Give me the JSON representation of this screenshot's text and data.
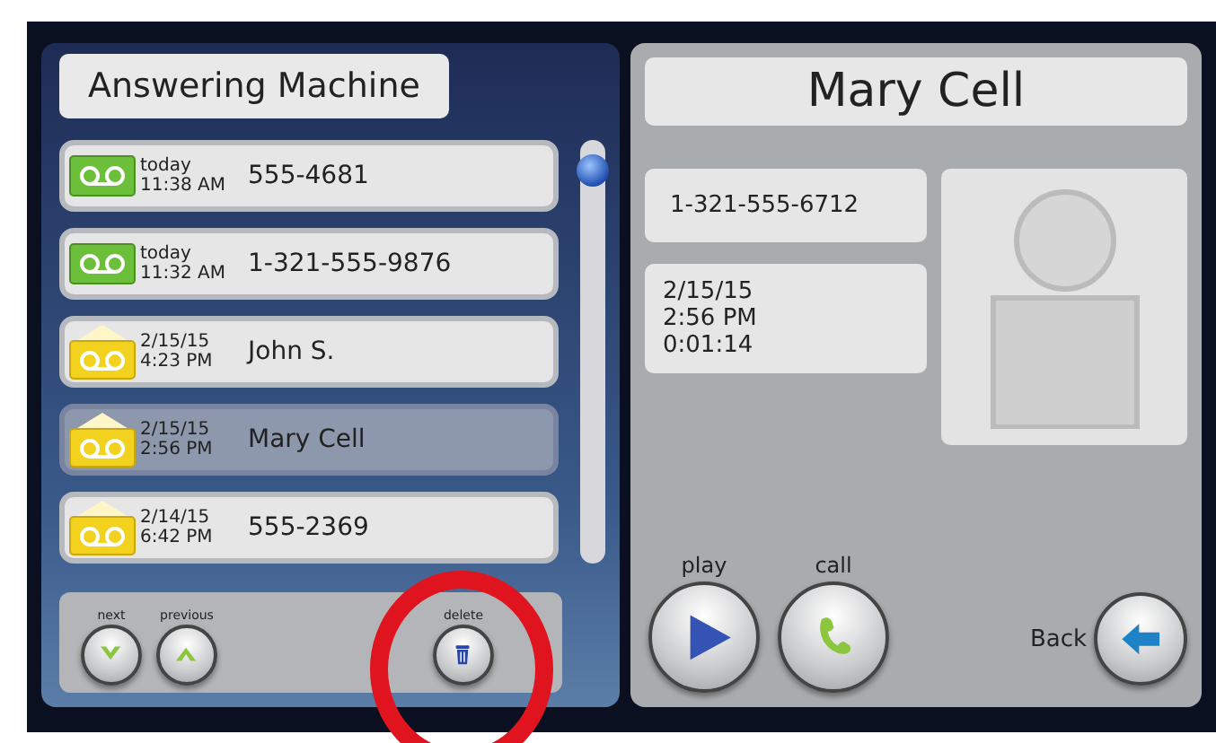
{
  "list_title": "Answering Machine",
  "messages": [
    {
      "date": "today",
      "time": "11:38 AM",
      "caller": "555-4681",
      "new": true,
      "selected": false
    },
    {
      "date": "today",
      "time": "11:32 AM",
      "caller": "1-321-555-9876",
      "new": true,
      "selected": false
    },
    {
      "date": "2/15/15",
      "time": "4:23 PM",
      "caller": "John S.",
      "new": false,
      "selected": false
    },
    {
      "date": "2/15/15",
      "time": "2:56 PM",
      "caller": "Mary Cell",
      "new": false,
      "selected": true
    },
    {
      "date": "2/14/15",
      "time": "6:42 PM",
      "caller": "555-2369",
      "new": false,
      "selected": false
    }
  ],
  "nav_buttons": [
    {
      "label": "next",
      "kind": "down"
    },
    {
      "label": "previous",
      "kind": "up"
    },
    {
      "label": "delete",
      "kind": "trash"
    }
  ],
  "detail": {
    "name": "Mary Cell",
    "number": "1-321-555-6712",
    "info_lines": [
      "2/15/15",
      "2:56 PM",
      "0:01:14"
    ]
  },
  "actions": [
    {
      "label": "play",
      "kind": "play"
    },
    {
      "label": "call",
      "kind": "phone"
    }
  ],
  "back": {
    "label": "Back"
  }
}
